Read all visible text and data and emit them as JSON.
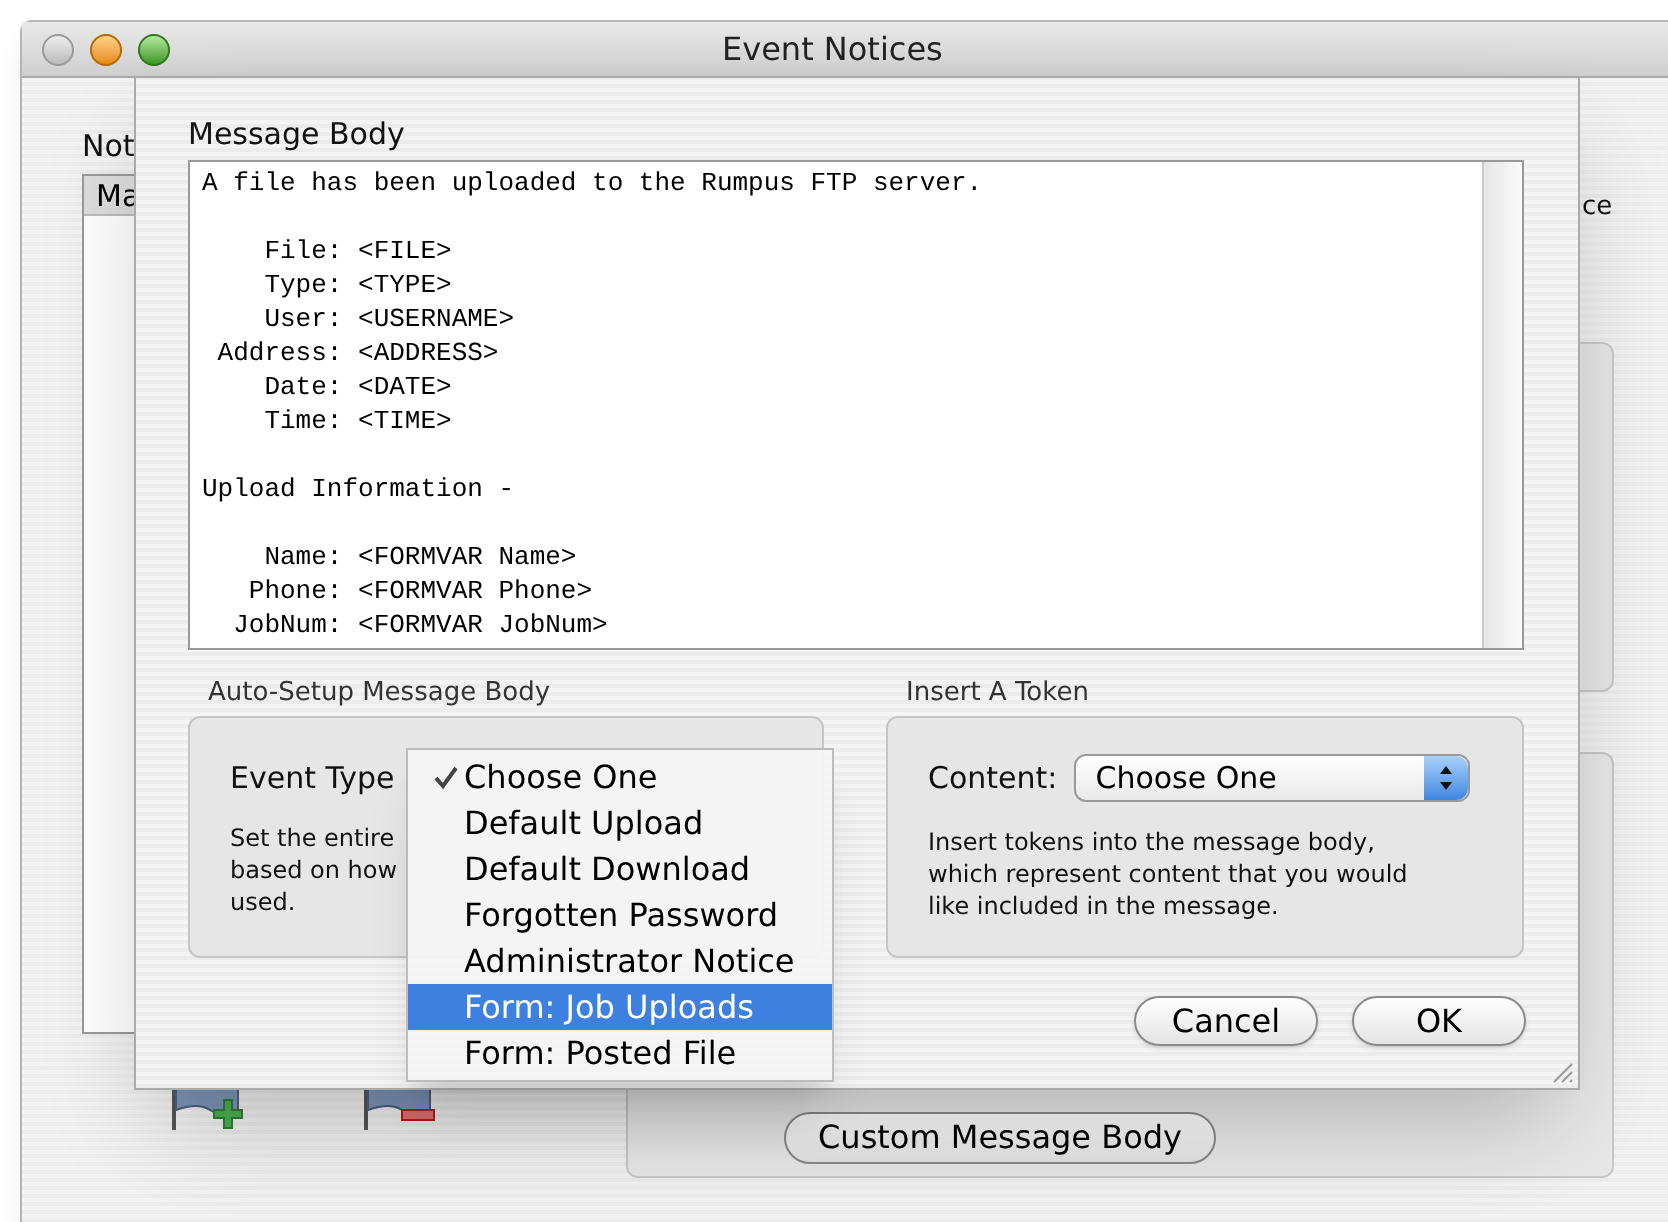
{
  "window": {
    "title": "Event Notices"
  },
  "background": {
    "notices_label": "Not",
    "list_header": "Ma",
    "right_label": "ce",
    "custom_button": "Custom Message Body"
  },
  "sheet": {
    "message_body_label": "Message Body",
    "message_blocks": [
      [
        "A file has been uploaded to the Rumpus FTP server."
      ],
      [
        "    File: <FILE>",
        "    Type: <TYPE>",
        "    User: <USERNAME>",
        " Address: <ADDRESS>",
        "    Date: <DATE>",
        "    Time: <TIME>"
      ],
      [
        "Upload Information -"
      ],
      [
        "    Name: <FORMVAR Name>",
        "   Phone: <FORMVAR Phone>",
        "  JobNum: <FORMVAR JobNum>"
      ]
    ],
    "auto_setup": {
      "title": "Auto-Setup Message Body",
      "label": "Event Type",
      "description": "Set the entire",
      "description_2": "based on how",
      "description_3": "used."
    },
    "token": {
      "title": "Insert A Token",
      "label": "Content:",
      "popup_value": "Choose One",
      "description": "Insert tokens into the message body, which represent content that you would like included in the message."
    },
    "buttons": [
      {
        "label": "Cancel",
        "default": false
      },
      {
        "label": "OK",
        "default": false
      }
    ]
  },
  "menu": {
    "items": [
      {
        "label": "Choose One",
        "checked": true,
        "selected": false
      },
      {
        "label": "Default Upload",
        "checked": false,
        "selected": false
      },
      {
        "label": "Default Download",
        "checked": false,
        "selected": false
      },
      {
        "label": "Forgotten Password",
        "checked": false,
        "selected": false
      },
      {
        "label": "Administrator Notice",
        "checked": false,
        "selected": false
      },
      {
        "label": "Form: Job Uploads",
        "checked": false,
        "selected": true
      },
      {
        "label": "Form: Posted File",
        "checked": false,
        "selected": false
      }
    ]
  }
}
